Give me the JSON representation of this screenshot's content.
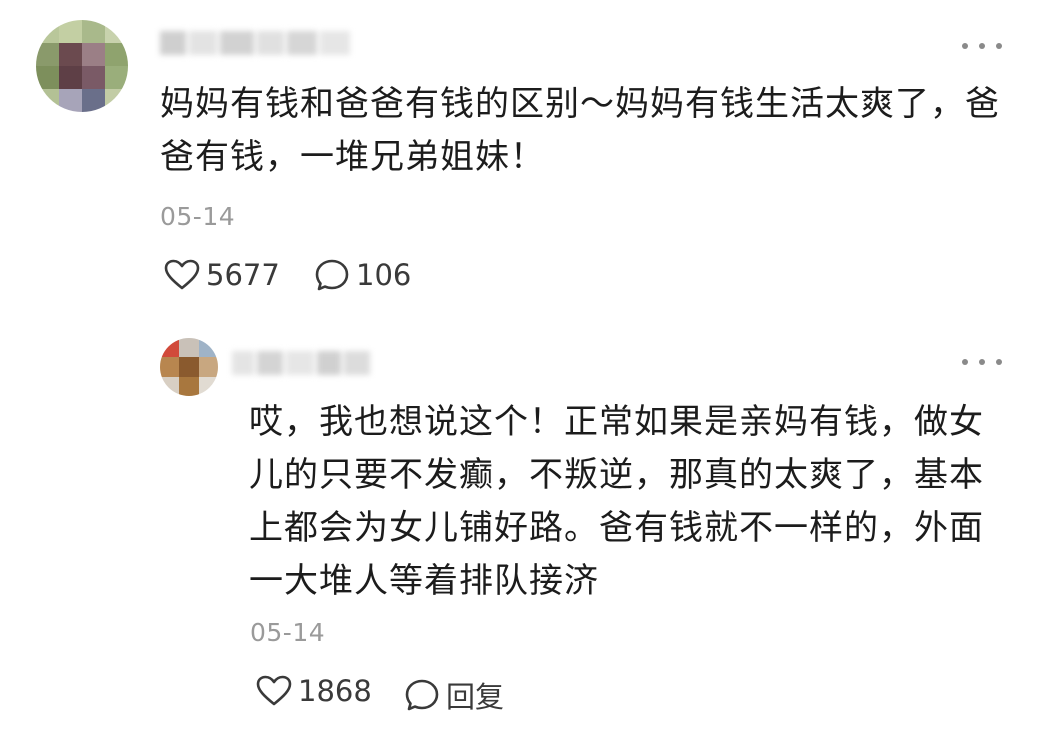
{
  "comment_main": {
    "text": "妈妈有钱和爸爸有钱的区别～妈妈有钱生活太爽了，爸爸有钱，一堆兄弟姐妹！",
    "date": "05-14",
    "like_count": "5677",
    "reply_count": "106",
    "avatar_icon": "blurred-avatar",
    "more_icon": "more-dots-icon"
  },
  "comment_reply": {
    "text": "哎，我也想说这个！正常如果是亲妈有钱，做女儿的只要不发癫，不叛逆，那真的太爽了，基本上都会为女儿铺好路。爸有钱就不一样的，外面一大堆人等着排队接济",
    "date": "05-14",
    "like_count": "1868",
    "reply_label": "回复",
    "avatar_icon": "blurred-avatar",
    "more_icon": "more-dots-icon"
  },
  "colors": {
    "text": "#1c1c1c",
    "muted": "#9a9a9a",
    "icon": "#3a3a3a"
  }
}
